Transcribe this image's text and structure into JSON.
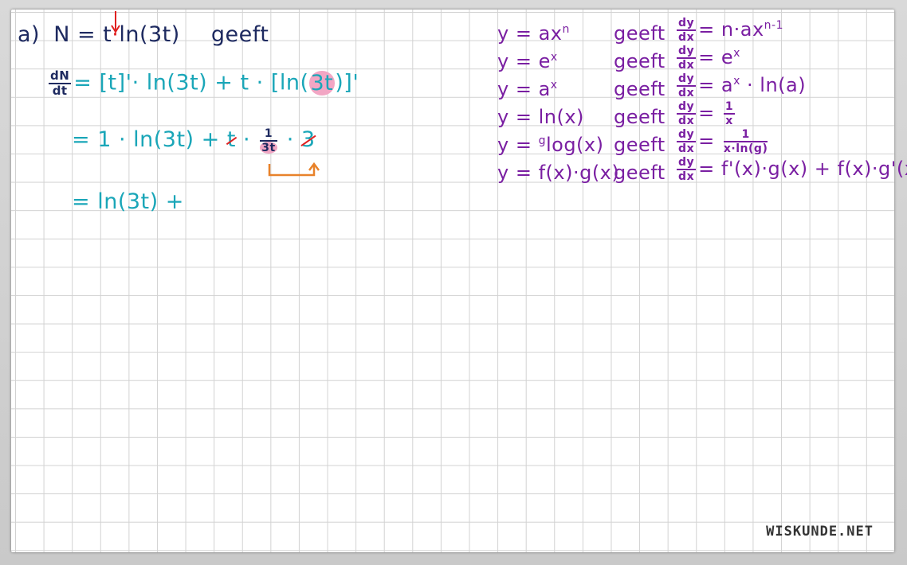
{
  "worksheet": {
    "line_a": {
      "label": "a)",
      "expr_prefix": "N = t",
      "dot": "·",
      "expr_suffix": "ln(3t)",
      "word": "geeft"
    },
    "line_derivative": {
      "lhs_num": "dN",
      "lhs_den": "dt",
      "rhs_part1": "= [t]'· ln(3t) + t · [ln(",
      "rhs_highlight": "3t",
      "rhs_part2": ")]'"
    },
    "line_step2": {
      "part1": "= 1 · ln(3t) + ",
      "struck_t": "t",
      "part2": " · ",
      "frac_num": "1",
      "frac_den": "3t",
      "part3": " · ",
      "struck_3": "3"
    },
    "line_step3": {
      "text": "= ln(3t) +"
    },
    "rules": [
      {
        "func": "y = ax",
        "func_sup": "n",
        "geeft": "geeft",
        "dnum": "dy",
        "dden": "dx",
        "result": "= n·ax",
        "result_sup": "n-1"
      },
      {
        "func": "y = e",
        "func_sup": "x",
        "geeft": "geeft",
        "dnum": "dy",
        "dden": "dx",
        "result": "= e",
        "result_sup": "x"
      },
      {
        "func": "y = a",
        "func_sup": "x",
        "geeft": "geeft",
        "dnum": "dy",
        "dden": "dx",
        "result": "= a",
        "result_sup": "x",
        "result_tail": " · ln(a)"
      },
      {
        "func": "y = ln(x)",
        "geeft": "geeft",
        "dnum": "dy",
        "dden": "dx",
        "result": "= ",
        "result_frac_num": "1",
        "result_frac_den": "x"
      },
      {
        "func_pre": "y = ",
        "func_sup_pre": "g",
        "func": "log(x)",
        "geeft": "geeft",
        "dnum": "dy",
        "dden": "dx",
        "result": "= ",
        "result_frac_num": "1",
        "result_frac_den": "x·ln(g)"
      },
      {
        "func": "y = f(x)·g(x)",
        "geeft": "geeft",
        "dnum": "dy",
        "dden": "dx",
        "result": "= f'(x)·g(x) + f(x)·g'(x)"
      }
    ],
    "watermark": "WISKUNDE.NET",
    "colors": {
      "navy": "#1e2a60",
      "teal": "#1aa6b8",
      "purple": "#7a1fa2",
      "red": "#e02020",
      "orange": "#e8822a",
      "highlight": "#f2a6c4"
    }
  }
}
